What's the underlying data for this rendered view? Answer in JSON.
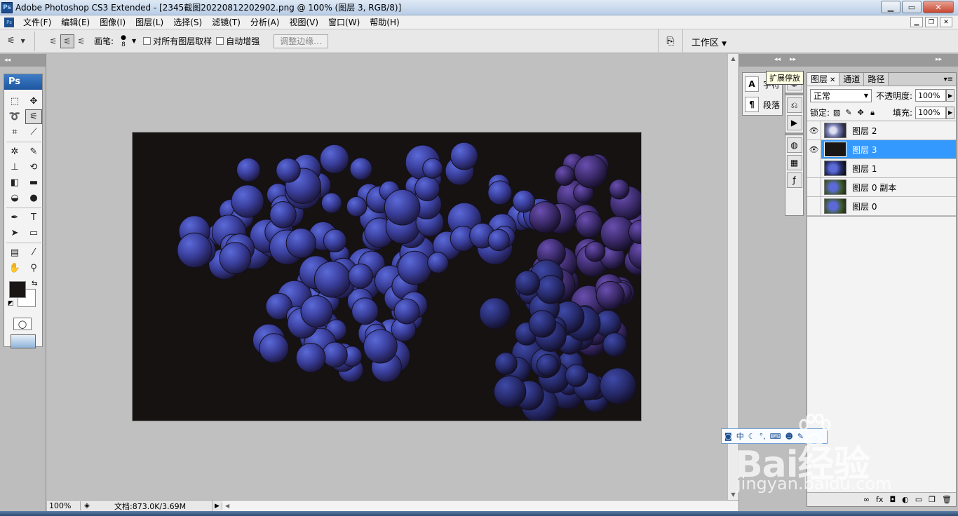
{
  "window": {
    "title": "Adobe Photoshop CS3 Extended - [2345截图20220812202902.png @ 100% (图层 3, RGB/8)]",
    "app_icon": "Ps"
  },
  "menu": {
    "items": [
      "文件(F)",
      "编辑(E)",
      "图像(I)",
      "图层(L)",
      "选择(S)",
      "滤镜(T)",
      "分析(A)",
      "视图(V)",
      "窗口(W)",
      "帮助(H)"
    ]
  },
  "options": {
    "brush_label": "画笔:",
    "brush_size": "8",
    "sample_all_layers": "对所有图层取样",
    "auto_enhance": "自动增强",
    "refine_edge": "调整边缘...",
    "workspace": "工作区"
  },
  "toolbox": {
    "title": "Ps",
    "foreground_color": "#1a1616",
    "background_color": "#ffffff"
  },
  "status": {
    "zoom": "100%",
    "doc_info": "文档:873.0K/3.69M"
  },
  "dock": {
    "character_label": "字符",
    "paragraph_label": "段落",
    "tooltip": "扩展停放"
  },
  "layers_panel": {
    "tabs": [
      {
        "label": "图层",
        "active": true
      },
      {
        "label": "通道",
        "active": false
      },
      {
        "label": "路径",
        "active": false
      }
    ],
    "blend_mode": "正常",
    "opacity_label": "不透明度:",
    "opacity_value": "100%",
    "lock_label": "锁定:",
    "fill_label": "填充:",
    "fill_value": "100%",
    "layers": [
      {
        "name": "图层 2",
        "visible": true,
        "selected": false,
        "thumb": "grapes-mono"
      },
      {
        "name": "图层 3",
        "visible": true,
        "selected": true,
        "thumb": "dark-fill"
      },
      {
        "name": "图层 1",
        "visible": false,
        "selected": false,
        "thumb": "grapes"
      },
      {
        "name": "图层 0 副本",
        "visible": false,
        "selected": false,
        "thumb": "grapes-green"
      },
      {
        "name": "图层 0",
        "visible": false,
        "selected": false,
        "thumb": "grapes-green"
      }
    ]
  },
  "ime": {
    "mode": "中"
  },
  "watermark": {
    "brand": "Bai经验",
    "url": "jingyan.baidu.com"
  },
  "colors": {
    "selection": "#3399ff",
    "canvas_bg": "#c0c0c0"
  }
}
